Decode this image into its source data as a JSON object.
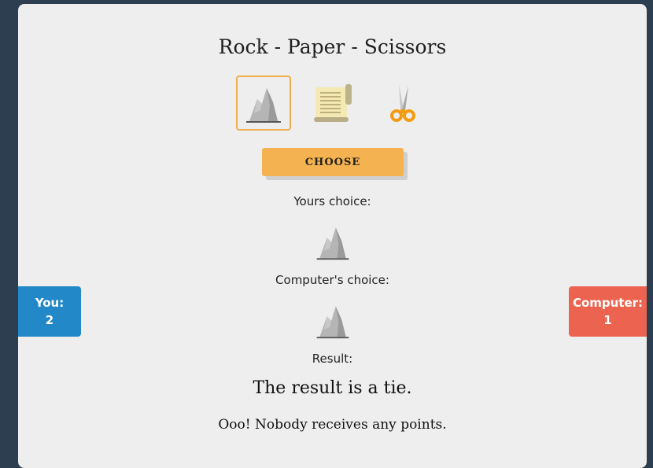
{
  "game": {
    "title": "Rock - Paper - Scissors",
    "options": [
      {
        "name": "rock",
        "icon": "rock-icon",
        "selected": true
      },
      {
        "name": "paper",
        "icon": "paper-scroll-icon",
        "selected": false
      },
      {
        "name": "scissors",
        "icon": "scissors-icon",
        "selected": false
      }
    ],
    "choose_label": "CHOOSE",
    "your_choice_label": "Yours choice:",
    "your_choice_icon": "rock-icon",
    "computer_choice_label": "Computer's choice:",
    "computer_choice_icon": "rock-icon",
    "result_label": "Result:",
    "result_text": "The result is a tie.",
    "result_detail": "Ooo! Nobody receives any points."
  },
  "scores": {
    "you_label": "You:",
    "you_value": "2",
    "computer_label": "Computer:",
    "computer_value": "1"
  },
  "colors": {
    "background": "#2c3e50",
    "card": "#eeeeee",
    "accent": "#f4b350",
    "you": "#2288c8",
    "computer": "#ec6450"
  }
}
